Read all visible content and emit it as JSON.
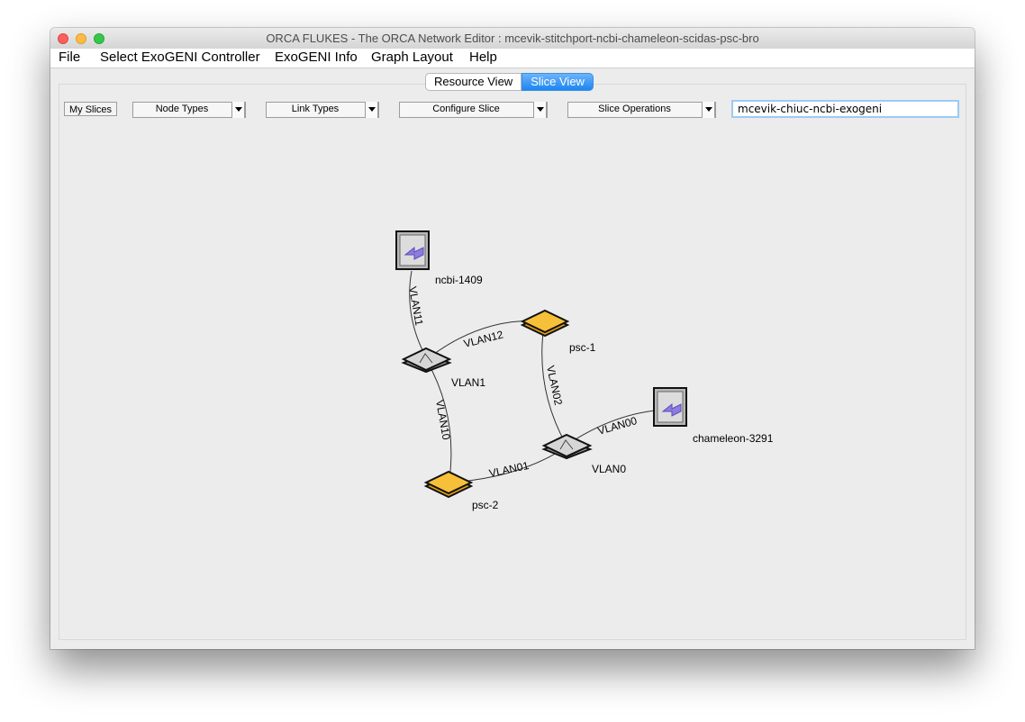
{
  "window": {
    "title": "ORCA FLUKES - The ORCA Network Editor : mcevik-stitchport-ncbi-chameleon-scidas-psc-bro"
  },
  "menu": [
    "File",
    "Select ExoGENI Controller",
    "ExoGENI Info",
    "Graph Layout",
    "Help"
  ],
  "tabs": [
    {
      "label": "Resource View",
      "active": false
    },
    {
      "label": "Slice View",
      "active": true
    }
  ],
  "toolbar": {
    "my_slices": "My Slices",
    "node_types": "Node Types",
    "link_types": "Link Types",
    "configure_slice": "Configure Slice",
    "slice_operations": "Slice Operations",
    "slice_name": "mcevik-chiuc-ncbi-exogeni"
  },
  "graph": {
    "nodes": {
      "ncbi": "ncbi-1409",
      "psc1": "psc-1",
      "vlan1": "VLAN1",
      "chameleon": "chameleon-3291",
      "vlan0": "VLAN0",
      "psc2": "psc-2"
    },
    "edges": {
      "vlan11": "VLAN11",
      "vlan12": "VLAN12",
      "vlan02": "VLAN02",
      "vlan10": "VLAN10",
      "vlan00": "VLAN00",
      "vlan01": "VLAN01"
    }
  },
  "colors": {
    "accent": "#1c86f2",
    "storage_node": "#f7b824",
    "stitch_icon": "#8c7be0"
  }
}
